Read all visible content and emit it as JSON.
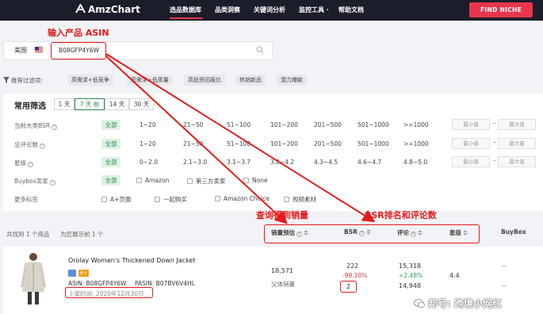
{
  "nav": {
    "logo": "AmzChart",
    "items": [
      "选品数据库",
      "品类洞察",
      "关键词分析",
      "监控工具 ·",
      "帮助文档"
    ],
    "cta": "FIND NICHE",
    "accent": "#e8364b"
  },
  "annotations": {
    "input_asin": "输入产品 ASIN",
    "query_sales": "查询得到销量",
    "bsr_reviews": "BSR排名和评论数",
    "color": "#e31b1b"
  },
  "search": {
    "country": "美国",
    "asin": "B08GFP4Y6W",
    "icon": "search-icon"
  },
  "recommend": {
    "label": "推荐过滤项:",
    "chips": [
      "高需求+低竞争",
      "高需求+低质量",
      "高投资回报比",
      "热销新品",
      "潜力爆款"
    ]
  },
  "filters": {
    "title": "常用筛选",
    "periods": [
      "1 天",
      "7 天 前",
      "14 天",
      "30 天"
    ],
    "rows": [
      {
        "label": "当前大类BSR",
        "all": "全部",
        "options": [
          "1~20",
          "21~50",
          "51~100",
          "101~200",
          "201~500",
          "501~1000",
          ">=1000"
        ]
      },
      {
        "label": "总评论数",
        "all": "全部",
        "options": [
          "1~20",
          "21~50",
          "51~100",
          "101~200",
          "201~500",
          "501~1000",
          ">=1000"
        ]
      },
      {
        "label": "星级",
        "all": "全部",
        "options": [
          "0~2.0",
          "2.1~3.0",
          "3.1~3.7",
          "3.8~4.2",
          "4.3~4.5",
          "4.6~4.7",
          "4.8~5.0"
        ]
      },
      {
        "label": "Buybox卖家",
        "all": "全部",
        "options": [
          "Amazon",
          "第三方卖家",
          "None"
        ]
      },
      {
        "label": "更多标签",
        "options": [
          "A+页面",
          "一起购买",
          "Amazon Choice",
          "视频素材"
        ]
      }
    ],
    "min_placeholder": "最小值",
    "max_placeholder": "最大值",
    "range_dash": "~"
  },
  "results": {
    "count": "共找到 1 个商品",
    "selected": "为您展示前 1 个",
    "columns": [
      "销量预估",
      "BSR",
      "评论",
      "星级",
      "BuyBox"
    ],
    "product": {
      "title": "Orolay Women's Thickened Down Jacket",
      "aplus": "A+",
      "asin": "ASIN: B08GFP4Y6W",
      "pasin": "PASIN: B07BV6V4HL",
      "listed": "上架时间: 2020年12月30日",
      "sales": "18,571",
      "sales_sub": "父体销量",
      "bsr": "222",
      "bsr_change": "-99.10%",
      "bsr_sub": "2",
      "reviews": "15,318",
      "reviews_change": "+2.48%",
      "reviews_prev": "14,948",
      "rating": "4.4",
      "buybox1": "--",
      "buybox2": "--"
    }
  },
  "watermark": "邦号: 跨境小网红"
}
